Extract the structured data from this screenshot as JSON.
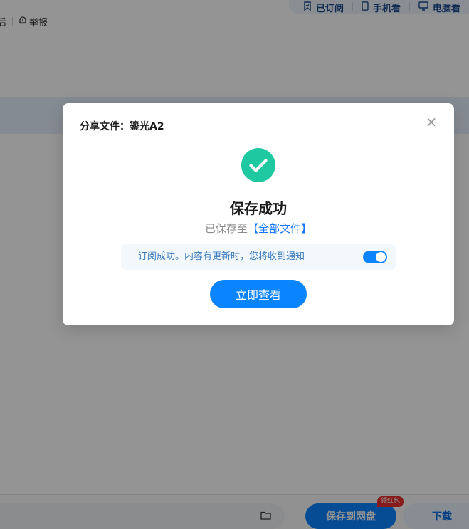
{
  "header": {
    "subscribed_label": "已订阅",
    "mobile_view_label": "手机看",
    "pc_view_label": "电脑看"
  },
  "toolbar": {
    "clipped_label": "后",
    "report_label": "举报"
  },
  "modal": {
    "title": "分享文件：鎏光A2",
    "close_glyph": "×",
    "success_title": "保存成功",
    "saved_prefix": "已保存至",
    "saved_link": "【全部文件】",
    "notify_text": "订阅成功。内容有更新时，您将收到通知",
    "notify_toggle_on": true,
    "view_button_label": "立即查看"
  },
  "bottom_bar": {
    "save_label": "保存到网盘",
    "badge_label": "领红包",
    "download_label": "下载"
  },
  "colors": {
    "accent": "#0a84ff",
    "success": "#1ec8a0",
    "overlay": "rgba(0,0,0,0.42)"
  },
  "icons": {
    "success": "check-circle-icon",
    "close": "close-icon",
    "subscribe": "bookmark-check-icon",
    "mobile": "phone-icon",
    "pc": "monitor-icon",
    "report": "alert-icon",
    "folder": "folder-icon"
  }
}
